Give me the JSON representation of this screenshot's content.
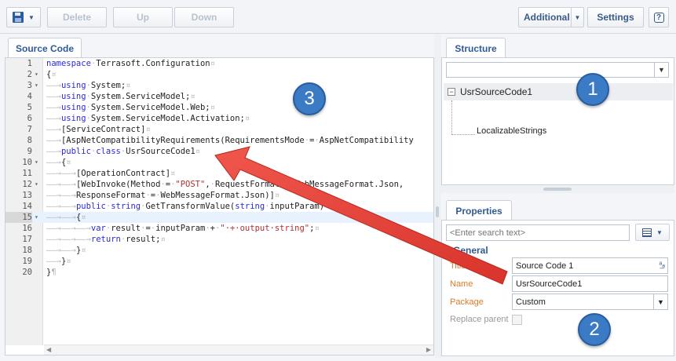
{
  "toolbar": {
    "delete_label": "Delete",
    "up_label": "Up",
    "down_label": "Down",
    "additional_label": "Additional",
    "settings_label": "Settings",
    "help_glyph": "?"
  },
  "source_panel": {
    "tab_label": "Source Code",
    "lines": [
      {
        "n": "1",
        "fold": "",
        "html": "<span class='kw'>namespace</span><span class='ws'>·</span>Terrasoft.Configuration<span class='ws'>¤</span>"
      },
      {
        "n": "2",
        "fold": "▾",
        "html": "{<span class='ws'>¤</span>"
      },
      {
        "n": "3",
        "fold": "▾",
        "html": "<span class='ws'>——→</span><span class='kw'>using</span><span class='ws'>·</span>System;<span class='ws'>¤</span>"
      },
      {
        "n": "4",
        "fold": "",
        "html": "<span class='ws'>——→</span><span class='kw'>using</span><span class='ws'>·</span>System.ServiceModel;<span class='ws'>¤</span>"
      },
      {
        "n": "5",
        "fold": "",
        "html": "<span class='ws'>——→</span><span class='kw'>using</span><span class='ws'>·</span>System.ServiceModel.Web;<span class='ws'>¤</span>"
      },
      {
        "n": "6",
        "fold": "",
        "html": "<span class='ws'>——→</span><span class='kw'>using</span><span class='ws'>·</span>System.ServiceModel.Activation;<span class='ws'>¤</span>"
      },
      {
        "n": "7",
        "fold": "",
        "html": "<span class='ws'>——→</span>[ServiceContract]<span class='ws'>¤</span>"
      },
      {
        "n": "8",
        "fold": "",
        "html": "<span class='ws'>——→</span>[AspNetCompatibilityRequirements(RequirementsMode<span class='ws'>·</span>=<span class='ws'>·</span>AspNetCompatibility"
      },
      {
        "n": "9",
        "fold": "",
        "html": "<span class='ws'>——→</span><span class='kw'>public</span><span class='ws'>·</span><span class='kw'>class</span><span class='ws'>·</span>UsrSourceCode1<span class='ws'>¤</span>"
      },
      {
        "n": "10",
        "fold": "▾",
        "html": "<span class='ws'>——→</span>{<span class='ws'>¤</span>"
      },
      {
        "n": "11",
        "fold": "",
        "html": "<span class='ws'>——→——→</span>[OperationContract]<span class='ws'>¤</span>"
      },
      {
        "n": "12",
        "fold": "▾",
        "html": "<span class='ws'>——→——→</span>[WebInvoke(Method<span class='ws'>·</span>=<span class='ws'>·</span><span class='str'>\"POST\"</span>,<span class='ws'>·</span>RequestFormat<span class='ws'>·</span>=<span class='ws'>·</span>WebMessageFormat.Json,"
      },
      {
        "n": "13",
        "fold": "",
        "html": "<span class='ws'>——→——→</span>ResponseFormat<span class='ws'>·</span>=<span class='ws'>·</span>WebMessageFormat.Json)]<span class='ws'>¤</span>"
      },
      {
        "n": "14",
        "fold": "",
        "html": "<span class='ws'>——→——→</span><span class='kw'>public</span><span class='ws'>·</span><span class='kw'>string</span><span class='ws'>·</span>GetTransformValue(<span class='kw'>string</span><span class='ws'>·</span>inputParam)"
      },
      {
        "n": "15",
        "fold": "▾",
        "html": "<span class='ws'>——→——→</span>{<span class='ws'>¤</span>"
      },
      {
        "n": "16",
        "fold": "",
        "html": "<span class='ws'>——→——→——→</span><span class='kw'>var</span><span class='ws'>·</span>result<span class='ws'>·</span>=<span class='ws'>·</span>inputParam<span class='ws'>·</span>+<span class='ws'>·</span><span class='str'>\"·+·output·string\"</span>;<span class='ws'>¤</span>"
      },
      {
        "n": "17",
        "fold": "",
        "html": "<span class='ws'>——→——→——→</span><span class='kw'>return</span><span class='ws'>·</span>result;<span class='ws'>¤</span>"
      },
      {
        "n": "18",
        "fold": "",
        "html": "<span class='ws'>——→——→</span>}<span class='ws'>¤</span>"
      },
      {
        "n": "19",
        "fold": "",
        "html": "<span class='ws'>——→</span>}<span class='ws'>¤</span>"
      },
      {
        "n": "20",
        "fold": "",
        "html": "}<span class='ws'>¶</span>"
      }
    ],
    "active_line": 15
  },
  "structure_panel": {
    "tab_label": "Structure",
    "root_label": "UsrSourceCode1",
    "root_toggle": "−",
    "child_label": "LocalizableStrings"
  },
  "properties_panel": {
    "tab_label": "Properties",
    "search_placeholder": "<Enter search text>",
    "section_title": "General",
    "fields": {
      "title_label": "Title",
      "title_value": "Source Code 1",
      "name_label": "Name",
      "name_value": "UsrSourceCode1",
      "package_label": "Package",
      "package_value": "Custom",
      "replace_parent_label": "Replace parent"
    }
  },
  "callouts": {
    "one": "1",
    "two": "2",
    "three": "3"
  },
  "colors": {
    "callout_fill": "#3b7ac4",
    "arrow": "#e8403a",
    "keyword": "#2b2bd1",
    "field_label": "#e07a26"
  }
}
